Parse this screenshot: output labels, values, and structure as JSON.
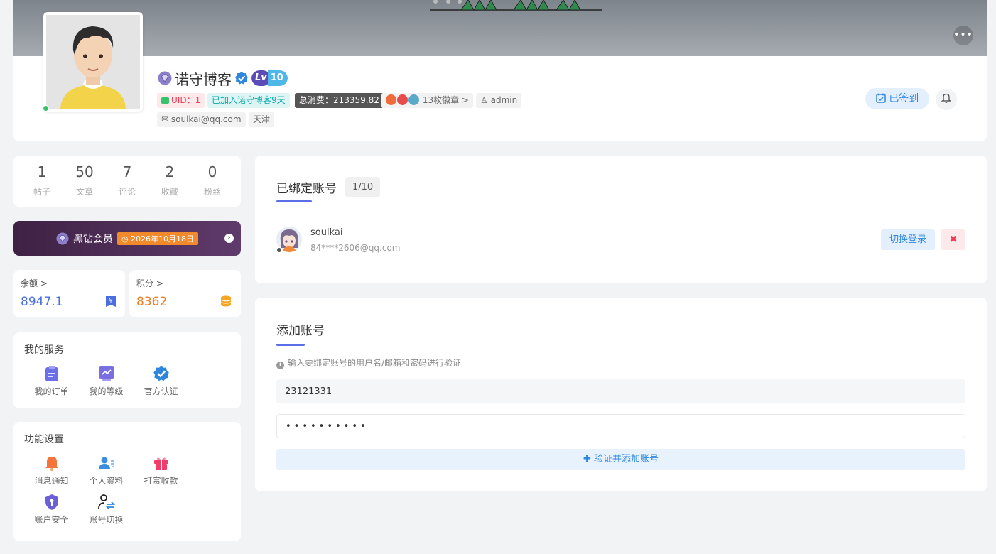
{
  "header": {
    "user_name": "诺守博客",
    "level_prefix": "Lv",
    "level_value": "10",
    "uid": "UID：1",
    "joined": "已加入诺守博客9天",
    "total_spend": "总消费：213359.82",
    "badges": "13枚徽章 >",
    "role": "admin",
    "email": "soulkai@qq.com",
    "city": "天津",
    "checkin_label": "已签到",
    "more_label": "•••"
  },
  "stats": [
    {
      "value": "1",
      "label": "帖子"
    },
    {
      "value": "50",
      "label": "文章"
    },
    {
      "value": "7",
      "label": "评论"
    },
    {
      "value": "2",
      "label": "收藏"
    },
    {
      "value": "0",
      "label": "粉丝"
    }
  ],
  "vip": {
    "title": "黑钻会员",
    "expire": "2026年10月18日"
  },
  "wallet": {
    "balance_label": "余额 >",
    "balance_value": "8947.1",
    "points_label": "积分 >",
    "points_value": "8362"
  },
  "services": {
    "title": "我的服务",
    "items": [
      "我的订单",
      "我的等级",
      "官方认证"
    ]
  },
  "settings": {
    "title": "功能设置",
    "items": [
      "消息通知",
      "个人资料",
      "打赏收款",
      "账户安全",
      "账号切换"
    ]
  },
  "bound": {
    "title": "已绑定账号",
    "count": "1/10",
    "account_name": "soulkai",
    "account_email": "84****2606@qq.com",
    "switch_label": "切换登录",
    "remove_label": "✖"
  },
  "add": {
    "title": "添加账号",
    "hint": "输入要绑定账号的用户名/邮箱和密码进行验证",
    "username_value": "23121331",
    "password_value": "••••••••••",
    "submit_label": "✚ 验证并添加账号"
  },
  "colors": {
    "accent": "#2e86de",
    "balance": "#4a6ee0",
    "points": "#f07b1d",
    "vip_bg": "#3e2143"
  }
}
